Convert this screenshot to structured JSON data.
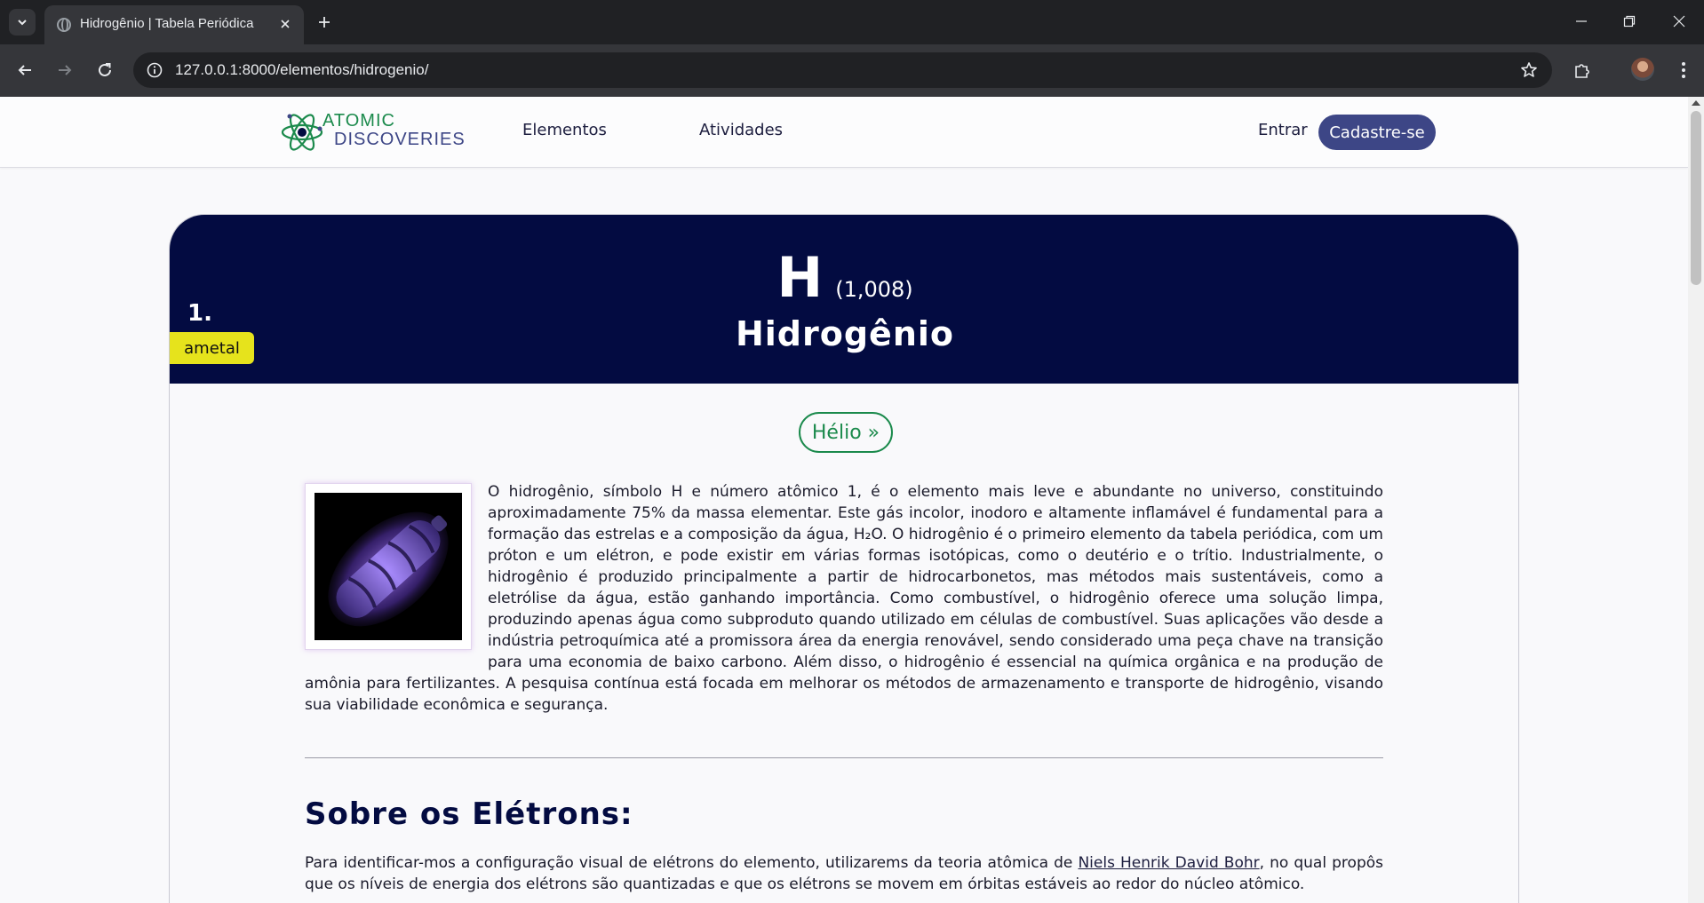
{
  "browser": {
    "tab_title": "Hidrogênio | Tabela Periódica",
    "url": "127.0.0.1:8000/elementos/hidrogenio/"
  },
  "site": {
    "logo_line1": "ATOMIC",
    "logo_line2": "DISCOVERIES",
    "nav": [
      "Elementos",
      "Atividades"
    ],
    "login_label": "Entrar",
    "signup_label": "Cadastre-se",
    "colors": {
      "navy": "#030b41",
      "green": "#1b8a4c",
      "accent": "#3d4686",
      "badge": "#e6e31c"
    }
  },
  "element": {
    "number": "1.",
    "category": "ametal",
    "symbol": "H",
    "mass": "(1,008)",
    "name": "Hidrogênio",
    "next_label": "Hélio »",
    "description": "O hidrogênio, símbolo H e número atômico 1, é o elemento mais leve e abundante no universo, constituindo aproximadamente 75% da massa elementar. Este gás incolor, inodoro e altamente inflamável é fundamental para a formação das estrelas e a composição da água, H₂O. O hidrogênio é o primeiro elemento da tabela periódica, com um próton e um elétron, e pode existir em várias formas isotópicas, como o deutério e o trítio. Industrialmente, o hidrogênio é produzido principalmente a partir de hidrocarbonetos, mas métodos mais sustentáveis, como a eletrólise da água, estão ganhando importância. Como combustível, o hidrogênio oferece uma solução limpa, produzindo apenas água como subproduto quando utilizado em células de combustível. Suas aplicações vão desde a indústria petroquímica até a promissora área da energia renovável, sendo considerado uma peça chave na transição para uma economia de baixo carbono. Além disso, o hidrogênio é essencial na química orgânica e na produção de amônia para fertilizantes. A pesquisa contínua está focada em melhorar os métodos de armazenamento e transporte de hidrogênio, visando sua viabilidade econômica e segurança."
  },
  "electrons": {
    "title": "Sobre os Elétrons:",
    "text_before": "Para identificar-mos a configuração visual de elétrons do elemento, utilizarems da teoria atômica de ",
    "link_text": "Niels Henrik David Bohr",
    "text_after": ", no qual propôs que os níveis de energia dos elétrons são quantizadas e que os elétrons se movem em órbitas estáveis ao redor do núcleo atômico."
  }
}
